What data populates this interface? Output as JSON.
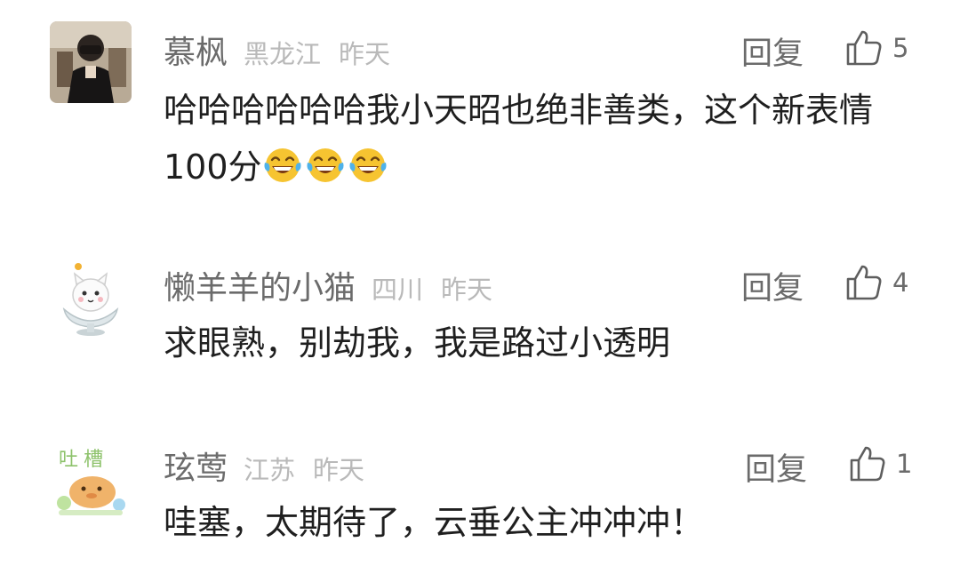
{
  "comments": [
    {
      "username": "慕枫",
      "region": "黑龙江",
      "time": "昨天",
      "reply_label": "回复",
      "likes": "5",
      "text": "哈哈哈哈哈哈我小天昭也绝非善类，这个新表情100分",
      "emoji": [
        "laughing-tears",
        "laughing-tears",
        "laughing-tears"
      ]
    },
    {
      "username": "懒羊羊的小猫",
      "region": "四川",
      "time": "昨天",
      "reply_label": "回复",
      "likes": "4",
      "text": "求眼熟，别劫我，我是路过小透明"
    },
    {
      "username": "玹莺",
      "region": "江苏",
      "time": "昨天",
      "reply_label": "回复",
      "likes": "1",
      "text": "哇塞，太期待了，云垂公主冲冲冲！"
    }
  ],
  "colors": {
    "name": "#6b6b6b",
    "meta": "#b9b9b9",
    "text": "#1f1f1f",
    "emoji": "#f6c431"
  }
}
